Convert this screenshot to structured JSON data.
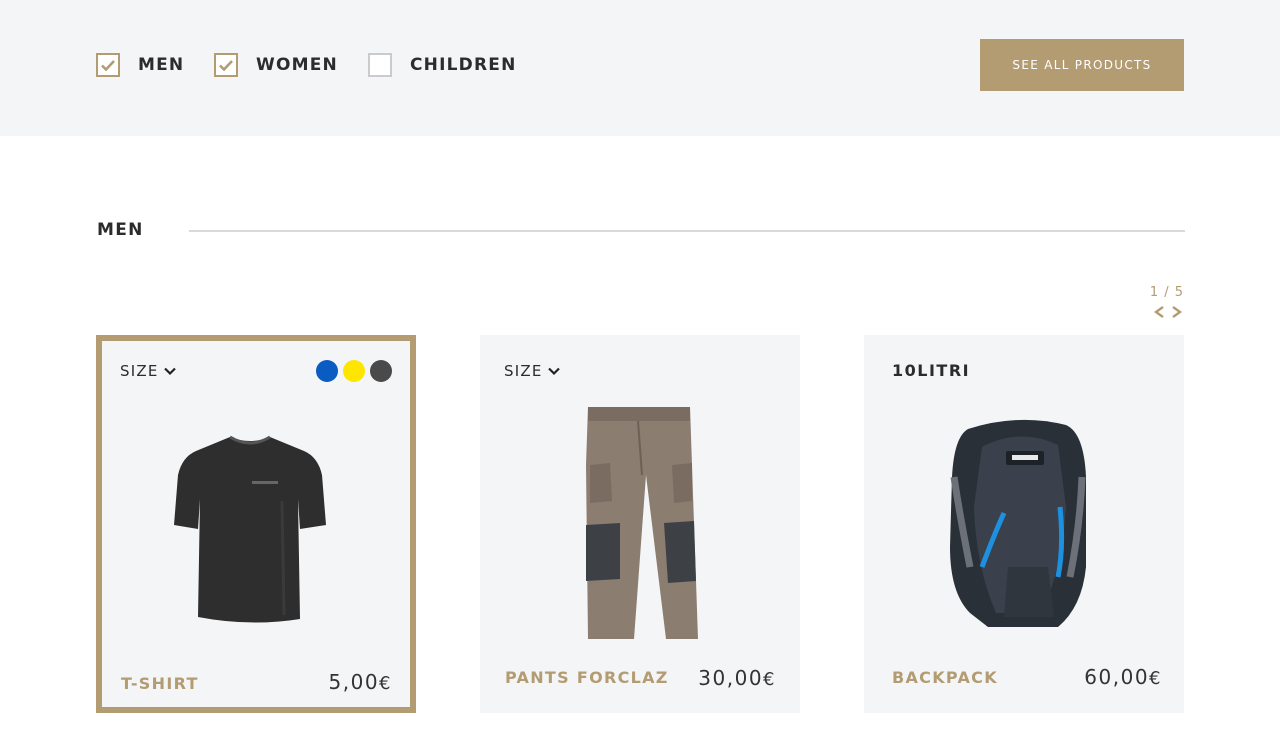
{
  "filters": [
    {
      "label": "MEN",
      "checked": true
    },
    {
      "label": "WOMEN",
      "checked": true
    },
    {
      "label": "CHILDREN",
      "checked": false
    }
  ],
  "see_all_label": "SEE ALL PRODUCTS",
  "section": {
    "title": "MEN",
    "pager": "1 / 5"
  },
  "products": [
    {
      "size_label": "SIZE",
      "colors": [
        "#0a5cc2",
        "#ffe600",
        "#4a4a4a"
      ],
      "name": "T-SHIRT",
      "price": "5,00",
      "currency": "€",
      "image": "tshirt-image"
    },
    {
      "size_label": "SIZE",
      "name": "PANTS FORCLAZ",
      "price": "30,00",
      "currency": "€",
      "image": "pants-image"
    },
    {
      "capacity": "10LITRI",
      "name": "BACKPACK",
      "price": "60,00",
      "currency": "€",
      "image": "backpack-image"
    }
  ],
  "colors": {
    "accent": "#b39b72",
    "filter_bg": "#f4f5f7",
    "card_bg": "#f4f5f7"
  }
}
